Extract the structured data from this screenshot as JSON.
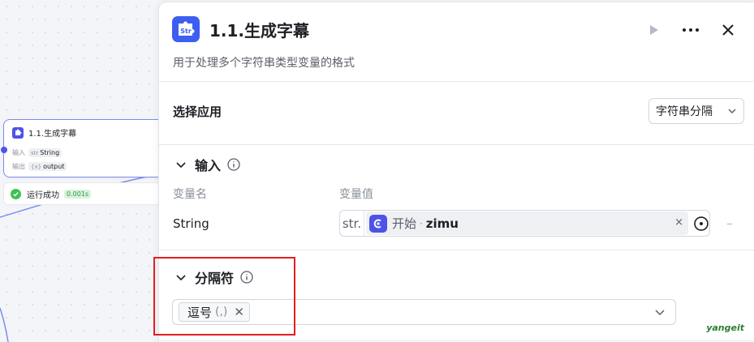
{
  "canvas": {
    "node": {
      "title": "1.1.生成字幕",
      "input_label": "输入",
      "input_type": "str",
      "input_name": "String",
      "output_label": "输出",
      "output_type": "{x}",
      "output_name": "output"
    },
    "status": {
      "text": "运行成功",
      "time": "0.001s"
    }
  },
  "panel": {
    "title": "1.1.生成字幕",
    "description": "用于处理多个字符串类型变量的格式",
    "app_icon_label": "Str",
    "select_app": {
      "label": "选择应用",
      "value": "字符串分隔"
    },
    "input_section": {
      "title": "输入",
      "col_name": "变量名",
      "col_value": "变量值",
      "row": {
        "name": "String",
        "type_tag": "str.",
        "source": "开始",
        "separator_dot": "·",
        "variable": "zimu",
        "clear": "×",
        "remove": "–"
      }
    },
    "separator_section": {
      "title": "分隔符",
      "chip_label": "逗号",
      "chip_hint": "(,)",
      "chip_remove": "✕"
    }
  },
  "watermark": "yangeit",
  "colors": {
    "accent": "#4d53e8",
    "success": "#3ec254",
    "highlight": "#e02020"
  }
}
